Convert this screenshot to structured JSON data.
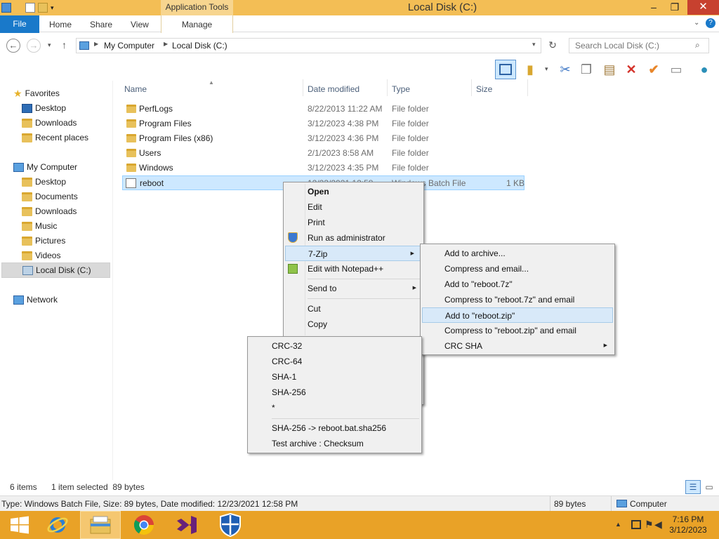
{
  "window": {
    "title": "Local Disk (C:)",
    "context_tab": "Application Tools"
  },
  "ribbon": {
    "file": "File",
    "home": "Home",
    "share": "Share",
    "view": "View",
    "manage": "Manage"
  },
  "address": {
    "path": [
      "My Computer",
      "Local Disk (C:)"
    ],
    "search_placeholder": "Search Local Disk (C:)"
  },
  "nav": {
    "favorites": "Favorites",
    "fav_items": [
      "Desktop",
      "Downloads",
      "Recent places"
    ],
    "computer": "My Computer",
    "computer_items": [
      "Desktop",
      "Documents",
      "Downloads",
      "Music",
      "Pictures",
      "Videos",
      "Local Disk (C:)"
    ],
    "network": "Network"
  },
  "columns": {
    "name": "Name",
    "date": "Date modified",
    "type": "Type",
    "size": "Size"
  },
  "files": [
    {
      "name": "PerfLogs",
      "date": "8/22/2013 11:22 AM",
      "type": "File folder",
      "size": ""
    },
    {
      "name": "Program Files",
      "date": "3/12/2023 4:38 PM",
      "type": "File folder",
      "size": ""
    },
    {
      "name": "Program Files (x86)",
      "date": "3/12/2023 4:36 PM",
      "type": "File folder",
      "size": ""
    },
    {
      "name": "Users",
      "date": "2/1/2023 8:58 AM",
      "type": "File folder",
      "size": ""
    },
    {
      "name": "Windows",
      "date": "3/12/2023 4:35 PM",
      "type": "File folder",
      "size": ""
    },
    {
      "name": "reboot",
      "date": "12/23/2021 12:58",
      "type": "Windows Batch File",
      "size": "1 KB"
    }
  ],
  "context_menu": {
    "open": "Open",
    "edit": "Edit",
    "print": "Print",
    "run_as_admin": "Run as administrator",
    "seven_zip": "7-Zip",
    "notepadpp": "Edit with Notepad++",
    "send_to": "Send to",
    "cut": "Cut",
    "copy": "Copy"
  },
  "seven_zip_menu": {
    "add_archive": "Add to archive...",
    "compress_email": "Compress and email...",
    "add_7z": "Add to \"reboot.7z\"",
    "compress_7z_email": "Compress to \"reboot.7z\" and email",
    "add_zip": "Add to \"reboot.zip\"",
    "compress_zip_email": "Compress to \"reboot.zip\" and email",
    "crc_sha": "CRC SHA"
  },
  "crc_menu": {
    "crc32": "CRC-32",
    "crc64": "CRC-64",
    "sha1": "SHA-1",
    "sha256": "SHA-256",
    "all": "*",
    "sha256_file": "SHA-256 -> reboot.bat.sha256",
    "test_checksum": "Test archive : Checksum"
  },
  "status": {
    "items": "6 items",
    "selected": "1 item selected  89 bytes",
    "details": "Type: Windows Batch File, Size: 89 bytes, Date modified: 12/23/2021 12:58 PM",
    "size": "89 bytes",
    "location": "Computer"
  },
  "taskbar": {
    "time": "7:16 PM",
    "date": "3/12/2023"
  },
  "colors": {
    "titlebar": "#f3be55",
    "taskbar": "#e9a227",
    "file_tab": "#1979ca",
    "close": "#c7412f",
    "selection": "#cde8ff"
  }
}
